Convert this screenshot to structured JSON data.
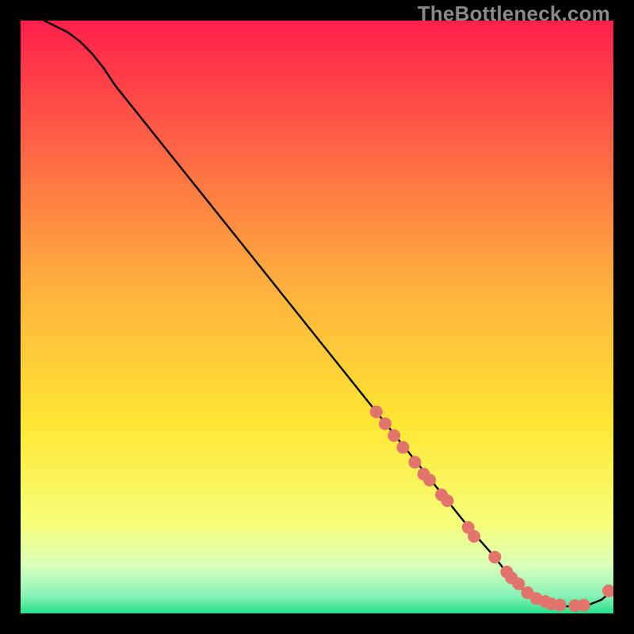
{
  "watermark": "TheBottleneck.com",
  "chart_data": {
    "type": "line",
    "title": "",
    "xlabel": "",
    "ylabel": "",
    "xlim": [
      0,
      100
    ],
    "ylim": [
      0,
      100
    ],
    "grid": false,
    "series": [
      {
        "name": "curve",
        "x": [
          4,
          6,
          8,
          10,
          12,
          14,
          16,
          20,
          24,
          28,
          32,
          36,
          40,
          44,
          48,
          52,
          56,
          60,
          64,
          68,
          72,
          76,
          80,
          83,
          86,
          88,
          90,
          92,
          94,
          96,
          98,
          100
        ],
        "y": [
          100,
          99,
          98,
          96.5,
          94.5,
          92,
          89,
          84,
          79,
          74,
          69,
          64,
          59,
          54,
          49,
          44,
          39,
          34,
          29,
          24,
          19,
          14,
          9.5,
          5.5,
          3,
          2,
          1.4,
          1.2,
          1.2,
          1.5,
          2.3,
          4
        ]
      }
    ],
    "markers": {
      "name": "points",
      "x": [
        60,
        61.5,
        63,
        64.5,
        66.5,
        68,
        69,
        71,
        72,
        75.5,
        76.5,
        80,
        82,
        82.8,
        84,
        85.5,
        87,
        88.5,
        89.5,
        91,
        93.5,
        95,
        99.2
      ],
      "y": [
        34,
        32,
        30,
        28,
        25.5,
        23.5,
        22.5,
        20,
        19,
        14.5,
        13,
        9.5,
        7,
        6,
        5,
        3.5,
        2.5,
        2,
        1.6,
        1.4,
        1.3,
        1.4,
        3.8
      ]
    },
    "colors": {
      "curve": "#000000",
      "markers": "#e2746b",
      "gradient_top": "#ff1f4b",
      "gradient_mid": "#ffda33",
      "gradient_green_pale": "#d8ffba",
      "gradient_green": "#26e08a"
    }
  }
}
